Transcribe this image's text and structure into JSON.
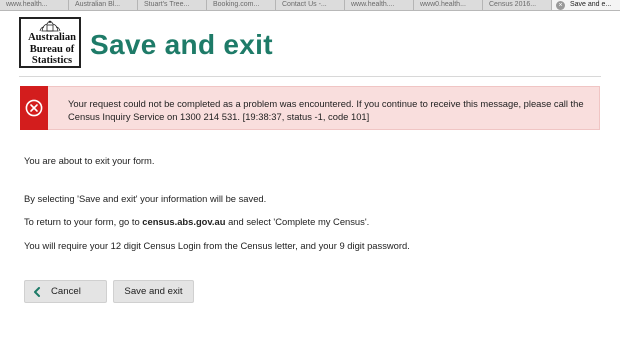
{
  "browser": {
    "tabs": [
      {
        "label": "www.health..."
      },
      {
        "label": "Australian Bl..."
      },
      {
        "label": "Stuart's Tree..."
      },
      {
        "label": "Booking.com..."
      },
      {
        "label": "Contact Us -..."
      },
      {
        "label": "www.health...."
      },
      {
        "label": "www0.health..."
      },
      {
        "label": "Census 2016..."
      },
      {
        "label": "Save and e...",
        "close_icon": "×"
      }
    ]
  },
  "header": {
    "logo_lines": [
      "Australian",
      "Bureau of",
      "Statistics"
    ],
    "title": "Save and exit"
  },
  "alert": {
    "icon": "error-circle-x",
    "message": "Your request could not be completed as a problem was encountered. If you continue to receive this message, please call the Census Inquiry Service on 1300 214 531. [19:38:37, status -1, code 101]",
    "colors": {
      "background": "#f9dedd",
      "accent": "#d31d1d"
    }
  },
  "content": {
    "intro": "You are about to exit your form.",
    "save_info": "By selecting 'Save and exit' your information will be saved.",
    "return_prefix": "To return to your form, go to ",
    "return_site": "census.abs.gov.au",
    "return_suffix": " and select 'Complete my Census'.",
    "login_info": "You will require your 12 digit Census Login from the Census letter, and your 9 digit password."
  },
  "buttons": {
    "cancel_label": "Cancel",
    "save_exit_label": "Save and exit"
  },
  "colors": {
    "title_green": "#1e7b68",
    "button_grey": "#e4e4e4"
  }
}
